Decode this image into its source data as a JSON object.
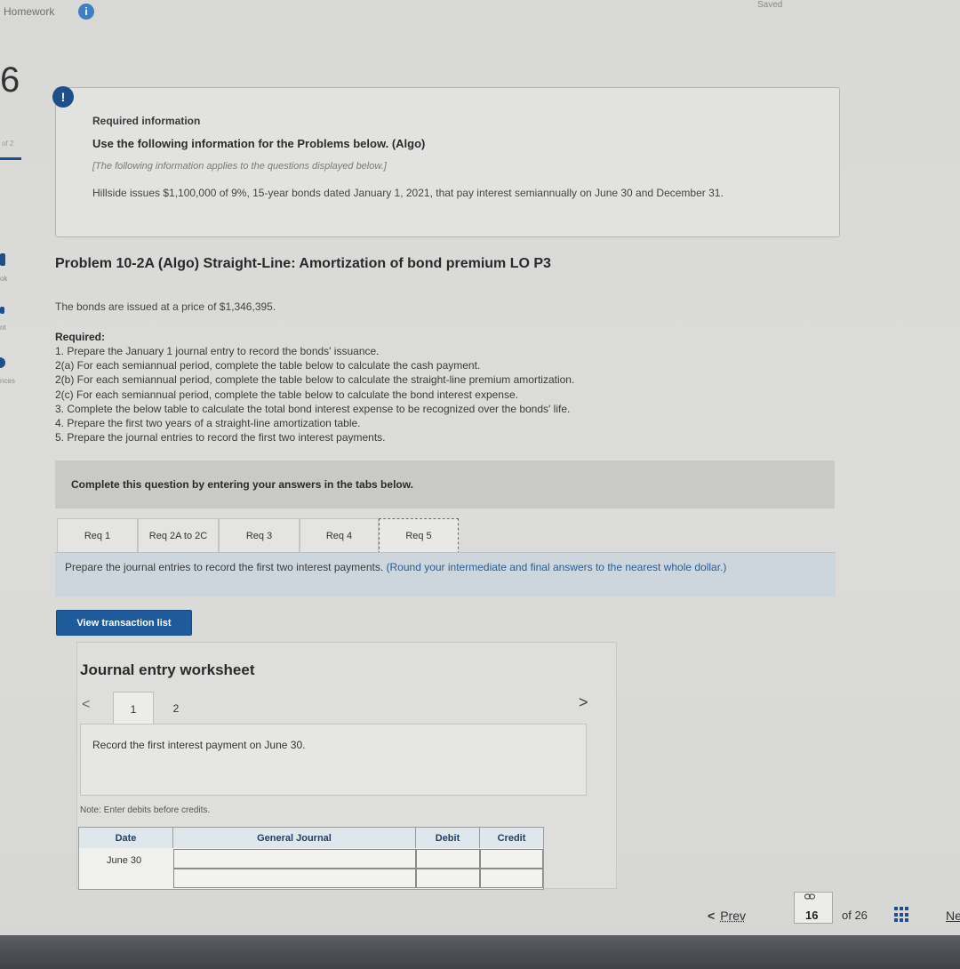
{
  "header": {
    "title": "Homework",
    "info_icon": "i",
    "saved_label": "Saved"
  },
  "sidebar": {
    "question_number": "6",
    "of_count": "of 2",
    "fragments": [
      "ok",
      "nt",
      "nces"
    ]
  },
  "required_info": {
    "icon": "!",
    "title": "Required information",
    "use_line": "Use the following information for the Problems below. (Algo)",
    "note": "[The following information applies to the questions displayed below.]",
    "body": "Hillside issues $1,100,000 of 9%, 15-year bonds dated January 1, 2021, that pay interest semiannually on June 30 and December 31."
  },
  "problem": {
    "title": "Problem 10-2A (Algo) Straight-Line: Amortization of bond premium LO P3",
    "issued_text": "The bonds are issued at a price of $1,346,395.",
    "required_label": "Required:",
    "requirements": [
      "1. Prepare the January 1 journal entry to record the bonds' issuance.",
      "2(a) For each semiannual period, complete the table below to calculate the cash payment.",
      "2(b) For each semiannual period, complete the table below to calculate the straight-line premium amortization.",
      "2(c) For each semiannual period, complete the table below to calculate the bond interest expense.",
      "3. Complete the below table to calculate the total bond interest expense to be recognized over the bonds' life.",
      "4. Prepare the first two years of a straight-line amortization table.",
      "5. Prepare the journal entries to record the first two interest payments."
    ]
  },
  "complete_panel": {
    "text": "Complete this question by entering your answers in the tabs below."
  },
  "tabs": [
    {
      "label": "Req 1"
    },
    {
      "label": "Req 2A to 2C"
    },
    {
      "label": "Req 3"
    },
    {
      "label": "Req 4"
    },
    {
      "label": "Req 5",
      "active": true
    }
  ],
  "instruction": {
    "main": "Prepare the journal entries to record the first two interest payments.",
    "paren": "(Round your intermediate and final answers to the nearest whole dollar.)"
  },
  "view_button": "View transaction list",
  "worksheet": {
    "title": "Journal entry worksheet",
    "prev_arrow": "<",
    "next_arrow": ">",
    "pages": [
      "1",
      "2"
    ],
    "record_text": "Record the first interest payment on June 30.",
    "note": "Note: Enter debits before credits.",
    "columns": [
      "Date",
      "General Journal",
      "Debit",
      "Credit"
    ],
    "rows": [
      {
        "date": "June 30",
        "account": "",
        "debit": "",
        "credit": ""
      },
      {
        "date": "",
        "account": "",
        "debit": "",
        "credit": ""
      }
    ]
  },
  "footer": {
    "prev_label": "Prev",
    "prev_chevron": "<",
    "current_page": "16",
    "of_total": "of 26",
    "next_label": "Ne"
  }
}
